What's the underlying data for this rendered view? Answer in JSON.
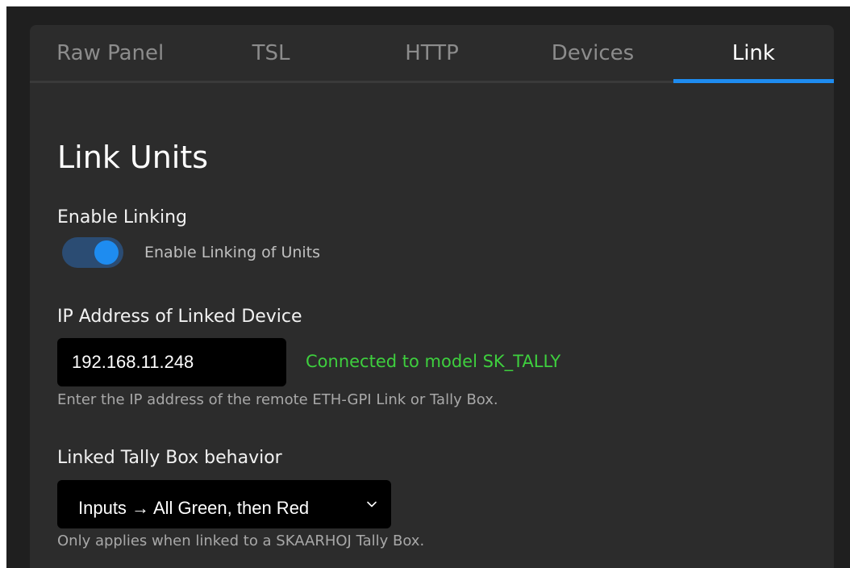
{
  "tabs": [
    {
      "label": "Raw Panel",
      "active": false
    },
    {
      "label": "TSL",
      "active": false
    },
    {
      "label": "HTTP",
      "active": false
    },
    {
      "label": "Devices",
      "active": false
    },
    {
      "label": "Link",
      "active": true
    }
  ],
  "section": {
    "title": "Link Units"
  },
  "enable_linking": {
    "label": "Enable Linking",
    "toggle_text": "Enable Linking of Units",
    "enabled": true
  },
  "ip_address": {
    "label": "IP Address of Linked Device",
    "value": "192.168.11.248",
    "status": "Connected to model SK_TALLY",
    "help": "Enter the IP address of the remote ETH-GPI Link or Tally Box."
  },
  "tally_behavior": {
    "label": "Linked Tally Box behavior",
    "selected": "Inputs → All Green, then Red",
    "help": "Only applies when linked to a SKAARHOJ Tally Box."
  },
  "colors": {
    "accent": "#1e8cf0",
    "toggle_track": "#2b4c73",
    "status_ok": "#3ecf3e",
    "panel_bg": "#2c2c2c",
    "outer_bg": "#1f1f1f"
  },
  "icons": {
    "select_arrow": "chevron-down-icon"
  }
}
